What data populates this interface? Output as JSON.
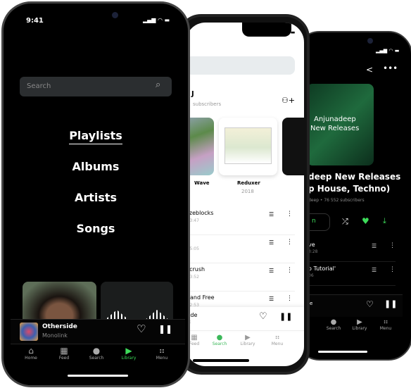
{
  "right_phone": {
    "cover_title_line1": "Anjunadeep",
    "cover_title_line2": "New Releases",
    "title_line1": "deep New Releases",
    "title_line2": "p House, Techno)",
    "subtitle": "deep  •  76 552 subscribers",
    "button_label": "n",
    "tracks": [
      {
        "title": "ve",
        "meta": "3:28"
      },
      {
        "title": "o Tutorial'",
        "meta": "06"
      }
    ],
    "player_title": "le",
    "nav": [
      "Search",
      "Library",
      "Menu"
    ],
    "accent": "#3ddc5a"
  },
  "middle_phone": {
    "header_title": "J",
    "subscribers": "subscribers",
    "albums": [
      {
        "title": "Wave",
        "year": ""
      },
      {
        "title": "Reduxer",
        "year": "2018"
      }
    ],
    "tracks": [
      {
        "title": "ezeblocks",
        "meta": "•  3:47"
      },
      {
        "title": "",
        "meta": "•  5:05"
      },
      {
        "title": "dcrush",
        "meta": "•  3:52"
      },
      {
        "title": " Hand Free",
        "meta": "•  2:53"
      }
    ],
    "player_title": "side",
    "player_artist": "nk",
    "nav": [
      "Feed",
      "Search",
      "Library",
      "Menu"
    ],
    "active_nav": "Search"
  },
  "left_phone": {
    "time": "9:41",
    "search_placeholder": "Search",
    "menu": [
      "Playlists",
      "Albums",
      "Artists",
      "Songs"
    ],
    "active_menu": "Playlists",
    "player": {
      "title": "Otherside",
      "artist": "Monolink"
    },
    "nav": [
      "Home",
      "Feed",
      "Search",
      "Library",
      "Menu"
    ],
    "active_nav": "Library"
  }
}
